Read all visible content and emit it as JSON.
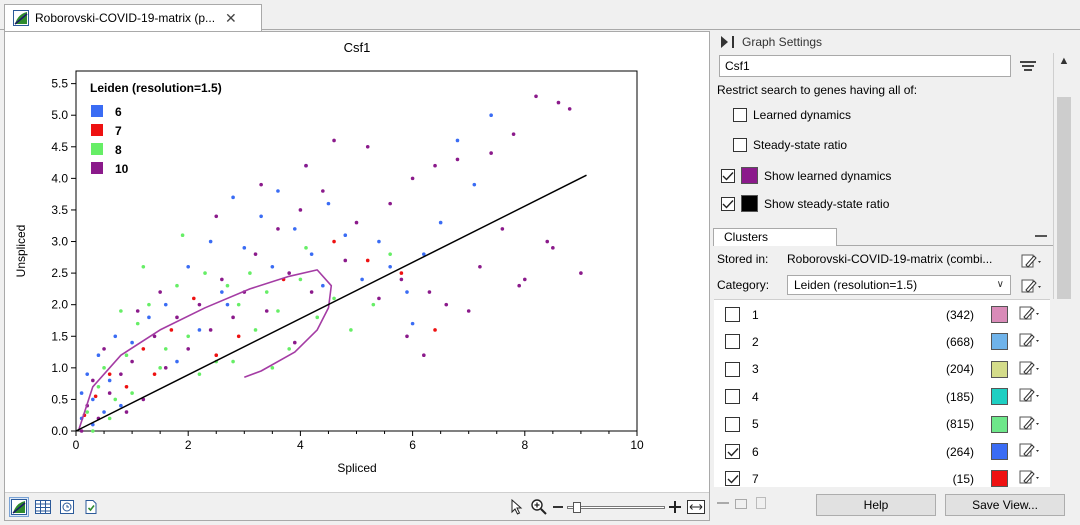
{
  "tab": {
    "title": "Roborovski-COVID-19-matrix (p...",
    "close": "✕"
  },
  "chart_data": {
    "type": "scatter",
    "title": "Csf1",
    "xlabel": "Spliced",
    "ylabel": "Unspliced",
    "xlim": [
      0,
      10
    ],
    "ylim": [
      0,
      5.7
    ],
    "xticks": [
      "0",
      "2",
      "4",
      "6",
      "8",
      "10"
    ],
    "yticks": [
      "0.0",
      "0.5",
      "1.0",
      "1.5",
      "2.0",
      "2.5",
      "3.0",
      "3.5",
      "4.0",
      "4.5",
      "5.0",
      "5.5"
    ],
    "legend": {
      "title": "Leiden (resolution=1.5)",
      "placement": "top-left",
      "entries": [
        {
          "name": "6",
          "color": "#3a6cf4"
        },
        {
          "name": "7",
          "color": "#ee1111"
        },
        {
          "name": "8",
          "color": "#66ee66"
        },
        {
          "name": "10",
          "color": "#8b1a8b"
        }
      ]
    },
    "series": [
      {
        "name": "6",
        "color": "#3a6cf4",
        "points": [
          [
            0.1,
            0.2
          ],
          [
            0.2,
            0.9
          ],
          [
            0.3,
            0.5
          ],
          [
            0.4,
            1.2
          ],
          [
            0.1,
            0.6
          ],
          [
            0.5,
            0.3
          ],
          [
            0.7,
            1.5
          ],
          [
            1.0,
            1.4
          ],
          [
            1.3,
            1.8
          ],
          [
            1.6,
            2.0
          ],
          [
            2.0,
            2.6
          ],
          [
            2.4,
            3.0
          ],
          [
            2.6,
            2.2
          ],
          [
            2.8,
            3.7
          ],
          [
            3.0,
            2.9
          ],
          [
            3.3,
            3.4
          ],
          [
            3.6,
            3.8
          ],
          [
            3.9,
            3.2
          ],
          [
            4.1,
            4.2
          ],
          [
            4.2,
            2.8
          ],
          [
            4.5,
            3.6
          ],
          [
            4.8,
            3.1
          ],
          [
            5.1,
            2.4
          ],
          [
            5.4,
            3.0
          ],
          [
            5.6,
            2.6
          ],
          [
            6.2,
            2.8
          ],
          [
            6.8,
            4.6
          ],
          [
            7.1,
            3.9
          ],
          [
            7.4,
            5.0
          ],
          [
            0.3,
            0.1
          ],
          [
            0.6,
            0.8
          ],
          [
            0.8,
            0.4
          ],
          [
            1.8,
            1.1
          ],
          [
            2.2,
            1.6
          ],
          [
            3.5,
            2.6
          ],
          [
            4.4,
            2.3
          ],
          [
            5.9,
            2.2
          ],
          [
            6.5,
            3.3
          ],
          [
            6.0,
            1.7
          ],
          [
            2.7,
            2.0
          ]
        ]
      },
      {
        "name": "7",
        "color": "#ee1111",
        "points": [
          [
            0.15,
            0.25
          ],
          [
            0.35,
            0.55
          ],
          [
            0.6,
            0.9
          ],
          [
            0.9,
            0.7
          ],
          [
            1.2,
            1.3
          ],
          [
            1.7,
            1.6
          ],
          [
            2.1,
            2.1
          ],
          [
            2.9,
            1.5
          ],
          [
            3.7,
            2.4
          ],
          [
            4.6,
            3.0
          ],
          [
            5.2,
            2.7
          ],
          [
            5.8,
            2.5
          ],
          [
            6.4,
            1.6
          ],
          [
            1.4,
            0.9
          ],
          [
            2.5,
            1.2
          ]
        ]
      },
      {
        "name": "8",
        "color": "#66ee66",
        "points": [
          [
            0.2,
            0.3
          ],
          [
            0.4,
            0.7
          ],
          [
            0.5,
            1.0
          ],
          [
            0.7,
            0.5
          ],
          [
            0.9,
            1.2
          ],
          [
            1.1,
            1.7
          ],
          [
            1.3,
            2.0
          ],
          [
            1.5,
            1.0
          ],
          [
            1.8,
            2.3
          ],
          [
            2.0,
            1.5
          ],
          [
            2.3,
            2.5
          ],
          [
            2.5,
            1.1
          ],
          [
            2.7,
            2.3
          ],
          [
            2.9,
            2.0
          ],
          [
            3.1,
            2.5
          ],
          [
            3.2,
            1.6
          ],
          [
            3.4,
            2.2
          ],
          [
            3.6,
            1.9
          ],
          [
            3.8,
            1.3
          ],
          [
            4.0,
            2.4
          ],
          [
            4.3,
            1.8
          ],
          [
            4.6,
            2.1
          ],
          [
            4.9,
            1.6
          ],
          [
            5.3,
            2.0
          ],
          [
            5.6,
            2.8
          ],
          [
            0.3,
            0.0
          ],
          [
            0.6,
            0.2
          ],
          [
            1.0,
            0.6
          ],
          [
            1.6,
            1.3
          ],
          [
            2.2,
            0.9
          ],
          [
            2.8,
            1.1
          ],
          [
            3.5,
            1.0
          ],
          [
            4.1,
            2.9
          ],
          [
            1.9,
            3.1
          ],
          [
            1.2,
            2.6
          ],
          [
            0.8,
            1.9
          ]
        ]
      },
      {
        "name": "10",
        "color": "#8b1a8b",
        "points": [
          [
            0.1,
            0.0
          ],
          [
            0.2,
            0.4
          ],
          [
            0.3,
            0.8
          ],
          [
            0.4,
            0.2
          ],
          [
            0.5,
            1.3
          ],
          [
            0.6,
            0.6
          ],
          [
            0.8,
            0.9
          ],
          [
            1.0,
            1.1
          ],
          [
            1.2,
            0.5
          ],
          [
            1.4,
            1.5
          ],
          [
            1.6,
            1.0
          ],
          [
            1.8,
            1.8
          ],
          [
            2.0,
            1.3
          ],
          [
            2.2,
            2.0
          ],
          [
            2.4,
            1.6
          ],
          [
            2.6,
            2.4
          ],
          [
            2.8,
            1.8
          ],
          [
            3.0,
            2.2
          ],
          [
            3.2,
            2.8
          ],
          [
            3.4,
            1.9
          ],
          [
            3.6,
            3.2
          ],
          [
            3.8,
            2.5
          ],
          [
            4.0,
            3.5
          ],
          [
            4.2,
            2.2
          ],
          [
            4.4,
            3.8
          ],
          [
            4.6,
            4.6
          ],
          [
            4.8,
            2.7
          ],
          [
            5.0,
            3.3
          ],
          [
            5.2,
            4.5
          ],
          [
            5.4,
            2.1
          ],
          [
            5.6,
            3.6
          ],
          [
            5.8,
            2.4
          ],
          [
            6.0,
            4.0
          ],
          [
            6.2,
            1.2
          ],
          [
            6.4,
            4.2
          ],
          [
            6.6,
            2.0
          ],
          [
            6.8,
            4.3
          ],
          [
            7.0,
            1.9
          ],
          [
            7.2,
            2.6
          ],
          [
            7.4,
            4.4
          ],
          [
            7.6,
            3.2
          ],
          [
            7.8,
            4.7
          ],
          [
            8.0,
            2.4
          ],
          [
            8.2,
            5.3
          ],
          [
            8.4,
            3.0
          ],
          [
            8.6,
            5.2
          ],
          [
            8.8,
            5.1
          ],
          [
            9.0,
            2.5
          ],
          [
            8.5,
            2.9
          ],
          [
            7.9,
            2.3
          ],
          [
            1.5,
            2.2
          ],
          [
            2.5,
            3.4
          ],
          [
            3.3,
            3.9
          ],
          [
            4.1,
            4.2
          ],
          [
            1.1,
            1.9
          ],
          [
            0.9,
            0.3
          ],
          [
            3.9,
            1.4
          ],
          [
            5.9,
            1.5
          ],
          [
            6.3,
            2.2
          ]
        ]
      }
    ],
    "fit_line": {
      "name": "steady-state ratio",
      "color": "#000000",
      "x": [
        0,
        9.1
      ],
      "y": [
        0,
        4.05
      ]
    },
    "dynamics_curve": {
      "name": "learned dynamics",
      "color": "#a43ca4",
      "x": [
        0.05,
        0.3,
        0.8,
        1.5,
        2.3,
        3.1,
        3.8,
        4.3,
        4.55,
        4.5,
        4.3,
        3.9,
        3.3,
        3.0
      ],
      "y": [
        0.02,
        0.7,
        1.2,
        1.6,
        1.95,
        2.25,
        2.45,
        2.55,
        2.3,
        1.95,
        1.6,
        1.25,
        0.95,
        0.85
      ]
    }
  },
  "graph_settings": {
    "header": "Graph Settings",
    "search_value": "Csf1",
    "restrict_label": "Restrict search to genes having all of:",
    "learned_dynamics": "Learned dynamics",
    "steady_state_ratio": "Steady-state ratio",
    "show_learned_dynamics": "Show learned dynamics",
    "show_steady_state_ratio": "Show steady-state ratio",
    "learned_color": "#8b1a8b",
    "steady_color": "#000000"
  },
  "clusters": {
    "tab": "Clusters",
    "stored_in_label": "Stored in:",
    "stored_in_value": "Roborovski-COVID-19-matrix (combi...",
    "category_label": "Category:",
    "category_value": "Leiden (resolution=1.5)",
    "items": [
      {
        "name": "1",
        "count": "(342)",
        "color": "#d98bb8",
        "checked": false
      },
      {
        "name": "2",
        "count": "(668)",
        "color": "#6fb3ea",
        "checked": false
      },
      {
        "name": "3",
        "count": "(204)",
        "color": "#d4dc8a",
        "checked": false
      },
      {
        "name": "4",
        "count": "(185)",
        "color": "#1ecfc2",
        "checked": false
      },
      {
        "name": "5",
        "count": "(815)",
        "color": "#6ee78a",
        "checked": false
      },
      {
        "name": "6",
        "count": "(264)",
        "color": "#3a6cf4",
        "checked": true
      },
      {
        "name": "7",
        "count": "(15)",
        "color": "#ee1111",
        "checked": true
      }
    ]
  },
  "buttons": {
    "help": "Help",
    "save_view": "Save View..."
  }
}
